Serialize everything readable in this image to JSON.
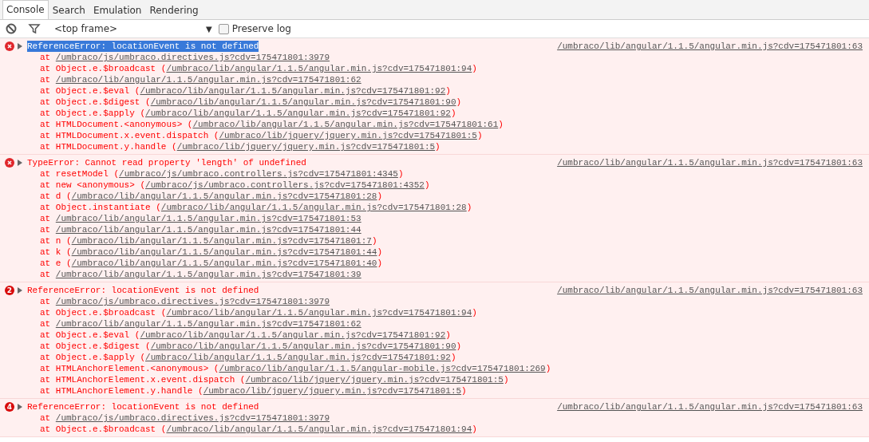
{
  "tabs": [
    {
      "label": "Console",
      "selected": true
    },
    {
      "label": "Search",
      "selected": false
    },
    {
      "label": "Emulation",
      "selected": false
    },
    {
      "label": "Rendering",
      "selected": false
    }
  ],
  "toolbar": {
    "frame": "<top frame>",
    "dropdown_arrow": "▼",
    "preserve_log": {
      "label": "Preserve log",
      "checked": false
    }
  },
  "messages": [
    {
      "expanded": false,
      "highlighted": true,
      "text": "ReferenceError: locationEvent is not defined",
      "source": "/umbraco/lib/angular/1.1.5/angular.min.js?cdv=175471801:63",
      "stack": [
        {
          "text": "at ",
          "link": "/umbraco/js/umbraco.directives.js?cdv=175471801:3979"
        },
        {
          "text": "at Object.e.$broadcast (",
          "link": "/umbraco/lib/angular/1.1.5/angular.min.js?cdv=175471801:94",
          "tail": ")"
        },
        {
          "text": "at ",
          "link": "/umbraco/lib/angular/1.1.5/angular.min.js?cdv=175471801:62"
        },
        {
          "text": "at Object.e.$eval (",
          "link": "/umbraco/lib/angular/1.1.5/angular.min.js?cdv=175471801:92",
          "tail": ")"
        },
        {
          "text": "at Object.e.$digest (",
          "link": "/umbraco/lib/angular/1.1.5/angular.min.js?cdv=175471801:90",
          "tail": ")"
        },
        {
          "text": "at Object.e.$apply (",
          "link": "/umbraco/lib/angular/1.1.5/angular.min.js?cdv=175471801:92",
          "tail": ")"
        },
        {
          "text": "at HTMLDocument.<anonymous> (",
          "link": "/umbraco/lib/angular/1.1.5/angular.min.js?cdv=175471801:61",
          "tail": ")"
        },
        {
          "text": "at HTMLDocument.x.event.dispatch (",
          "link": "/umbraco/lib/jquery/jquery.min.js?cdv=175471801:5",
          "tail": ")"
        },
        {
          "text": "at HTMLDocument.y.handle (",
          "link": "/umbraco/lib/jquery/jquery.min.js?cdv=175471801:5",
          "tail": ")"
        }
      ]
    },
    {
      "expanded": false,
      "highlighted": false,
      "text": "TypeError: Cannot read property 'length' of undefined",
      "source": "/umbraco/lib/angular/1.1.5/angular.min.js?cdv=175471801:63",
      "stack": [
        {
          "text": "at resetModel (",
          "link": "/umbraco/js/umbraco.controllers.js?cdv=175471801:4345",
          "tail": ")"
        },
        {
          "text": "at new <anonymous> (",
          "link": "/umbraco/js/umbraco.controllers.js?cdv=175471801:4352",
          "tail": ")"
        },
        {
          "text": "at d (",
          "link": "/umbraco/lib/angular/1.1.5/angular.min.js?cdv=175471801:28",
          "tail": ")"
        },
        {
          "text": "at Object.instantiate (",
          "link": "/umbraco/lib/angular/1.1.5/angular.min.js?cdv=175471801:28",
          "tail": ")"
        },
        {
          "text": "at ",
          "link": "/umbraco/lib/angular/1.1.5/angular.min.js?cdv=175471801:53"
        },
        {
          "text": "at ",
          "link": "/umbraco/lib/angular/1.1.5/angular.min.js?cdv=175471801:44"
        },
        {
          "text": "at n (",
          "link": "/umbraco/lib/angular/1.1.5/angular.min.js?cdv=175471801:7",
          "tail": ")"
        },
        {
          "text": "at k (",
          "link": "/umbraco/lib/angular/1.1.5/angular.min.js?cdv=175471801:44",
          "tail": ")"
        },
        {
          "text": "at e (",
          "link": "/umbraco/lib/angular/1.1.5/angular.min.js?cdv=175471801:40",
          "tail": ")"
        },
        {
          "text": "at ",
          "link": "/umbraco/lib/angular/1.1.5/angular.min.js?cdv=175471801:39"
        }
      ]
    },
    {
      "count": "2",
      "expanded": false,
      "highlighted": false,
      "text": "ReferenceError: locationEvent is not defined",
      "source": "/umbraco/lib/angular/1.1.5/angular.min.js?cdv=175471801:63",
      "stack": [
        {
          "text": "at ",
          "link": "/umbraco/js/umbraco.directives.js?cdv=175471801:3979"
        },
        {
          "text": "at Object.e.$broadcast (",
          "link": "/umbraco/lib/angular/1.1.5/angular.min.js?cdv=175471801:94",
          "tail": ")"
        },
        {
          "text": "at ",
          "link": "/umbraco/lib/angular/1.1.5/angular.min.js?cdv=175471801:62"
        },
        {
          "text": "at Object.e.$eval (",
          "link": "/umbraco/lib/angular/1.1.5/angular.min.js?cdv=175471801:92",
          "tail": ")"
        },
        {
          "text": "at Object.e.$digest (",
          "link": "/umbraco/lib/angular/1.1.5/angular.min.js?cdv=175471801:90",
          "tail": ")"
        },
        {
          "text": "at Object.e.$apply (",
          "link": "/umbraco/lib/angular/1.1.5/angular.min.js?cdv=175471801:92",
          "tail": ")"
        },
        {
          "text": "at HTMLAnchorElement.<anonymous> (",
          "link": "/umbraco/lib/angular/1.1.5/angular-mobile.js?cdv=175471801:269",
          "tail": ")"
        },
        {
          "text": "at HTMLAnchorElement.x.event.dispatch (",
          "link": "/umbraco/lib/jquery/jquery.min.js?cdv=175471801:5",
          "tail": ")"
        },
        {
          "text": "at HTMLAnchorElement.y.handle (",
          "link": "/umbraco/lib/jquery/jquery.min.js?cdv=175471801:5",
          "tail": ")"
        }
      ]
    },
    {
      "count": "4",
      "expanded": false,
      "highlighted": false,
      "text": "ReferenceError: locationEvent is not defined",
      "source": "/umbraco/lib/angular/1.1.5/angular.min.js?cdv=175471801:63",
      "stack": [
        {
          "text": "at ",
          "link": "/umbraco/js/umbraco.directives.js?cdv=175471801:3979"
        },
        {
          "text": "at Object.e.$broadcast (",
          "link": "/umbraco/lib/angular/1.1.5/angular.min.js?cdv=175471801:94",
          "tail": ")"
        }
      ]
    }
  ]
}
